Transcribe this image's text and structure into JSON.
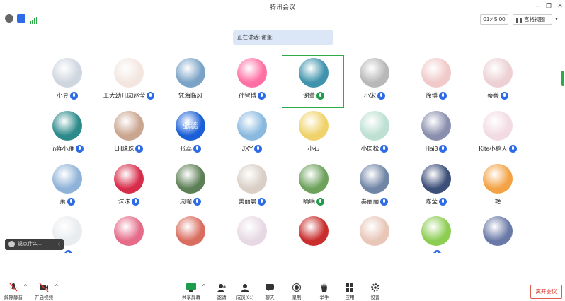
{
  "window": {
    "title": "腾讯会议",
    "minimize": "–",
    "restore": "❐",
    "close": "✕"
  },
  "infobar": {
    "timer": "01:45:00",
    "view_label": "宫格视图",
    "view_caret": "▾"
  },
  "speaking_banner": "正在讲话: 谢董;",
  "participants": [
    {
      "name": "小豆",
      "mic": "blue"
    },
    {
      "name": "工大幼儿园赵莹",
      "mic": "blue"
    },
    {
      "name": "凭海临风",
      "mic": "none"
    },
    {
      "name": "孙智博",
      "mic": "blue"
    },
    {
      "name": "谢董",
      "mic": "green",
      "active": true
    },
    {
      "name": "小宋",
      "mic": "blue"
    },
    {
      "name": "徐博",
      "mic": "blue"
    },
    {
      "name": "蔡蔡",
      "mic": "blue"
    },
    {
      "name": "ln蒋小雁",
      "mic": "blue"
    },
    {
      "name": "LH珠珠",
      "mic": "blue"
    },
    {
      "name": "张蕊",
      "mic": "blue"
    },
    {
      "name": "JXY",
      "mic": "blue"
    },
    {
      "name": "小石",
      "mic": "none"
    },
    {
      "name": "小肉松",
      "mic": "blue"
    },
    {
      "name": "Hai3",
      "mic": "blue"
    },
    {
      "name": "Kite小鹏天",
      "mic": "blue"
    },
    {
      "name": "萧",
      "mic": "blue"
    },
    {
      "name": "沫沫",
      "mic": "blue"
    },
    {
      "name": "周瑜",
      "mic": "blue"
    },
    {
      "name": "美丽晨",
      "mic": "blue"
    },
    {
      "name": "嘀嘀",
      "mic": "green"
    },
    {
      "name": "秦丽丽",
      "mic": "blue"
    },
    {
      "name": "陈莹",
      "mic": "blue"
    },
    {
      "name": "艳",
      "mic": "none"
    },
    {
      "name": "",
      "mic": "blue"
    },
    {
      "name": "",
      "mic": "none"
    },
    {
      "name": "",
      "mic": "none"
    },
    {
      "name": "",
      "mic": "none"
    },
    {
      "name": "",
      "mic": "none"
    },
    {
      "name": "",
      "mic": "none"
    },
    {
      "name": "",
      "mic": "blue"
    },
    {
      "name": "",
      "mic": "none"
    }
  ],
  "avatar_colors": [
    "#cfd6e0",
    "#f3e6e0",
    "#7aa3c7",
    "#ff6fa3",
    "#3f93ad",
    "#b8b8b8",
    "#f1c9c9",
    "#ecd0d4",
    "#2d8a8a",
    "#caa58f",
    "#1b5fd6",
    "#8ab9e0",
    "#f0d26a",
    "#bde0d2",
    "#8a8fae",
    "#f2dbe2",
    "#8fb3d8",
    "#d82d4a",
    "#5d7f55",
    "#d9cfc6",
    "#6ea25c",
    "#7186a6",
    "#3c4f79",
    "#f3a345",
    "#e8ecef",
    "#e56b89",
    "#d96d5f",
    "#e7d9e4",
    "#c92d2d",
    "#e8c6b8",
    "#8ccd52",
    "#6a7aa8"
  ],
  "avatar_text": {
    "10": "张蕊"
  },
  "chat": {
    "placeholder": "说点什么...",
    "collapse": "‹"
  },
  "toolbar": {
    "mute": "解除静音",
    "video": "开启视频",
    "share": "共享屏幕",
    "invite": "邀请",
    "members": "成员(61)",
    "chat": "聊天",
    "record": "录制",
    "hand": "举手",
    "apps": "应用",
    "settings": "设置",
    "leave": "离开会议",
    "caret": "^"
  },
  "colors": {
    "accent": "#2e6be6",
    "active_speaker": "#2faa4a",
    "leave": "#d9352b"
  }
}
